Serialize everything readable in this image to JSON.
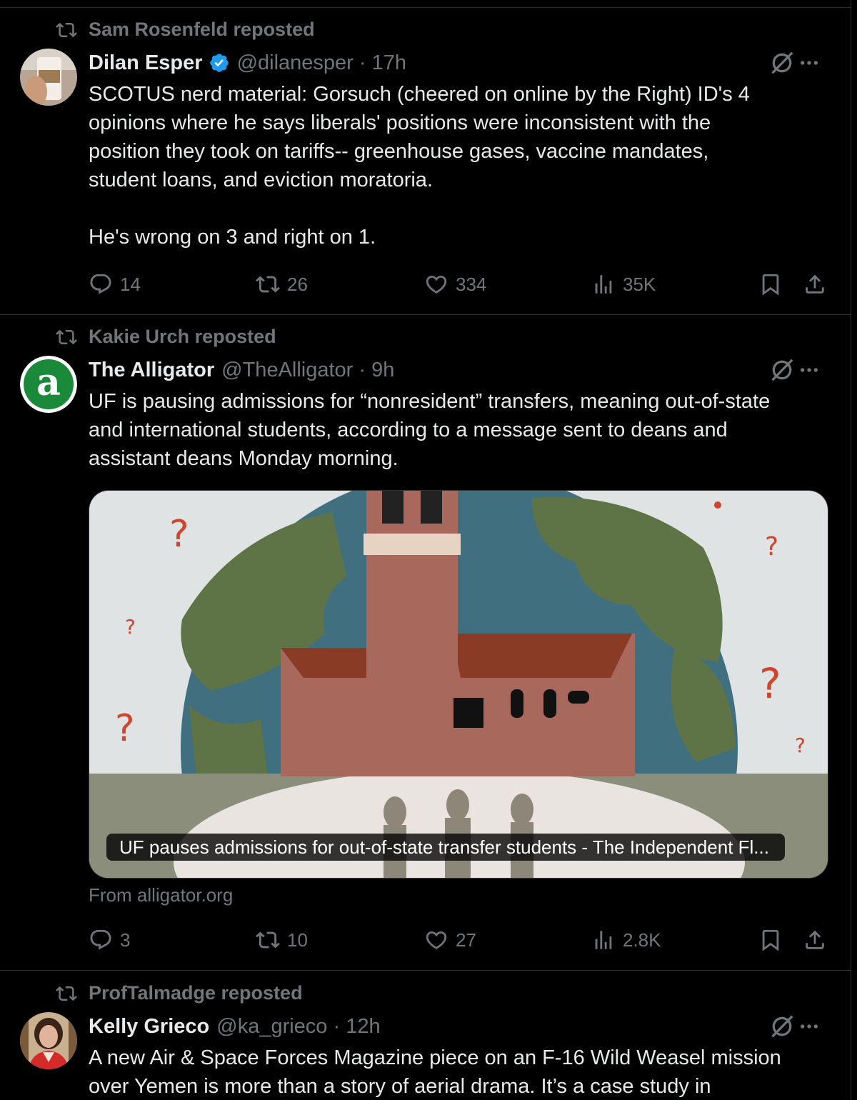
{
  "tweets": [
    {
      "reposted_by": "Sam Rosenfeld reposted",
      "name": "Dilan Esper",
      "verified": true,
      "handle_time": "@dilanesper · 17h",
      "text": "SCOTUS nerd material: Gorsuch (cheered on online by the Right) ID's 4\nopinions where he says liberals' positions were inconsistent with the\nposition they took on tariffs-- greenhouse gases, vaccine mandates,\nstudent loans, and eviction moratoria.\n\nHe's wrong on 3 and right on 1.",
      "replies": "14",
      "reposts": "26",
      "likes": "334",
      "views": "35K"
    },
    {
      "reposted_by": "Kakie Urch reposted",
      "name": "The Alligator",
      "verified": false,
      "handle_time": "@TheAlligator · 9h",
      "text": "UF is pausing admissions for “nonresident” transfers, meaning out-of-state\nand international students, according to a message sent to deans and\nassistant deans Monday morning.",
      "card_caption": "UF pauses admissions for out-of-state transfer students - The Independent Fl...",
      "card_from": "From alligator.org",
      "replies": "3",
      "reposts": "10",
      "likes": "27",
      "views": "2.8K"
    },
    {
      "reposted_by": "ProfTalmadge reposted",
      "name": "Kelly Grieco",
      "verified": false,
      "handle_time": "@ka_grieco · 12h",
      "text": "A new Air & Space Forces Magazine piece on an F-16 Wild Weasel mission\nover Yemen is more than a story of aerial drama. It’s a case study in"
    }
  ],
  "icons": {
    "repost": "repost-icon",
    "verified": "verified-badge-icon",
    "grok": "grok-icon",
    "more": "more-icon",
    "reply": "reply-icon",
    "like": "like-icon",
    "views": "views-icon",
    "bookmark": "bookmark-icon",
    "share": "share-icon"
  },
  "colors": {
    "background": "#000000",
    "text": "#e7e9ea",
    "secondary": "#71767b",
    "verified": "#1d9bf0",
    "divider": "#2f3336",
    "alligator_green": "#1a8a3a"
  }
}
